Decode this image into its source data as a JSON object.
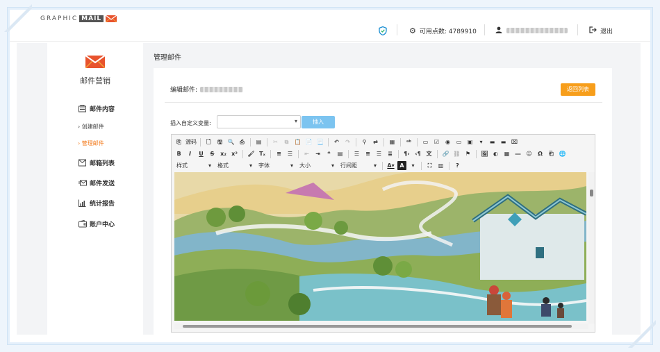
{
  "brand": {
    "logo_text": "GRAPHIC",
    "logo_mail": "MAIL"
  },
  "header": {
    "points_label": "可用点数: 4789910",
    "logout_label": "退出"
  },
  "sidebar": {
    "title": "邮件营销",
    "items": [
      {
        "label": "邮件内容",
        "icon": "content-icon"
      },
      {
        "label": "创建邮件",
        "sub": true
      },
      {
        "label": "管理邮件",
        "sub": true,
        "active": true
      },
      {
        "label": "邮箱列表",
        "icon": "mailbox-list-icon"
      },
      {
        "label": "邮件发送",
        "icon": "send-icon"
      },
      {
        "label": "统计报告",
        "icon": "chart-icon"
      },
      {
        "label": "账户中心",
        "icon": "wallet-icon"
      }
    ]
  },
  "main": {
    "page_title": "管理邮件",
    "edit_label": "编辑邮件:",
    "back_button": "返回列表",
    "insert_var_label": "插入自定义变量:",
    "insert_button": "插入",
    "var_select_value": ""
  },
  "editor": {
    "source_label": "源码",
    "style_combo": "样式",
    "format_combo": "格式",
    "font_combo": "字体",
    "size_combo": "大小",
    "line_height_combo": "行间距"
  },
  "colors": {
    "accent": "#f79e1b",
    "insert": "#7cc4f0",
    "active": "#f37b1d"
  }
}
